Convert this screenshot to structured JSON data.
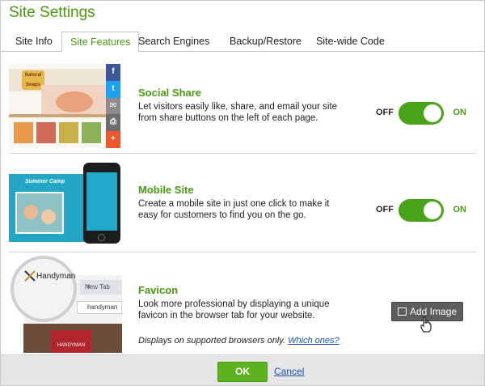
{
  "dialog": {
    "title": "Site Settings"
  },
  "tabs": [
    {
      "label": "Site Info",
      "active": false
    },
    {
      "label": "Site Features",
      "active": true
    },
    {
      "label": "Search Engines",
      "active": false
    },
    {
      "label": "Backup/Restore",
      "active": false
    },
    {
      "label": "Site-wide Code",
      "active": false
    }
  ],
  "features": {
    "social": {
      "title": "Social Share",
      "description": "Let visitors easily like, share, and email your site from share buttons on the left of each page.",
      "toggle_off": "OFF",
      "toggle_on": "ON",
      "enabled": true,
      "thumb_logo": "Natural Soaps",
      "share_icons": [
        "f",
        "t",
        "✉",
        "⎙",
        "+"
      ],
      "share_colors": [
        "#3b5998",
        "#1da1f2",
        "#8c8c8c",
        "#6d6d6d",
        "#f0572b"
      ]
    },
    "mobile": {
      "title": "Mobile Site",
      "description": "Create a mobile site in just one click to make it easy for customers to find you on the go.",
      "toggle_off": "OFF",
      "toggle_on": "ON",
      "enabled": true,
      "thumb_header": "Summer Camp"
    },
    "favicon": {
      "title": "Favicon",
      "description": "Look more professional by displaying a unique favicon in the browser tab for your website.",
      "note": "Displays on supported browsers only.",
      "note_link": "Which ones?",
      "add_image_label": "Add Image",
      "thumb_tab_text": "Handyman",
      "thumb_new_tab": "New Tab",
      "thumb_url": "handyman",
      "thumb_sign": "HANDYMAN"
    }
  },
  "footer": {
    "ok_label": "OK",
    "cancel_label": "Cancel"
  },
  "colors": {
    "accent": "#4a9a12",
    "toggle": "#4aa419",
    "link": "#1a4fbf"
  }
}
